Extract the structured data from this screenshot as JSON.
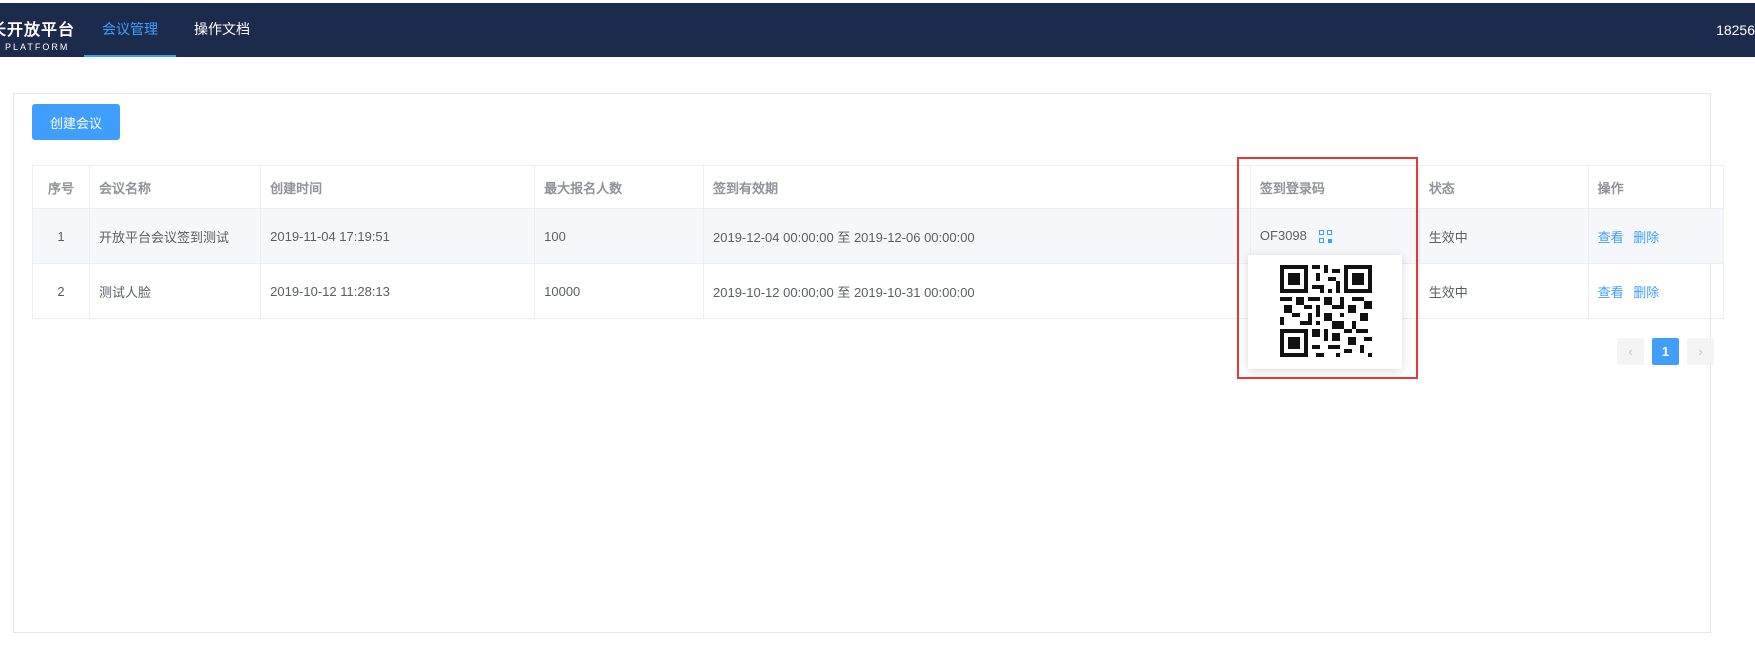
{
  "header": {
    "logo_title": "长开放平台",
    "logo_sub": "N PLATFORM",
    "nav": [
      {
        "label": "会议管理",
        "active": true
      },
      {
        "label": "操作文档",
        "active": false
      }
    ],
    "user": "18256"
  },
  "toolbar": {
    "create_label": "创建会议"
  },
  "table": {
    "headers": [
      "序号",
      "会议名称",
      "创建时间",
      "最大报名人数",
      "签到有效期",
      "签到登录码",
      "状态",
      "操作"
    ],
    "rows": [
      {
        "idx": "1",
        "name": "开放平台会议签到测试",
        "created": "2019-11-04 17:19:51",
        "max": "100",
        "validity": "2019-12-04 00:00:00 至 2019-12-06 00:00:00",
        "code": "OF3098",
        "status": "生效中",
        "view": "查看",
        "del": "删除"
      },
      {
        "idx": "2",
        "name": "测试人脸",
        "created": "2019-10-12 11:28:13",
        "max": "10000",
        "validity": "2019-10-12 00:00:00 至 2019-10-31 00:00:00",
        "code": "",
        "status": "生效中",
        "view": "查看",
        "del": "删除"
      }
    ]
  },
  "pagination": {
    "prev": "‹",
    "current": "1",
    "next": "›"
  },
  "colors": {
    "header_bg": "#1c2a4b",
    "accent": "#409eff",
    "status_green": "#67c23a",
    "highlight": "#e53935"
  },
  "icons": [
    "qr-code-icon",
    "chevron-left-icon",
    "chevron-right-icon"
  ]
}
